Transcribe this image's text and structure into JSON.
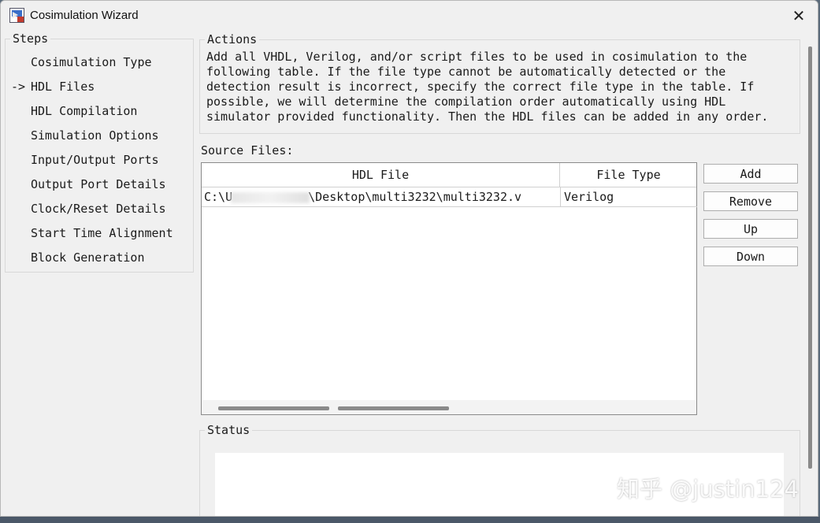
{
  "window": {
    "title": "Cosimulation Wizard",
    "close_glyph": "✕"
  },
  "icons": {
    "app": "cosimulation-app-icon",
    "close": "close-icon"
  },
  "steps": {
    "legend": "Steps",
    "current_marker": "->",
    "items": [
      {
        "label": "Cosimulation Type",
        "current": false
      },
      {
        "label": "HDL Files",
        "current": true
      },
      {
        "label": "HDL Compilation",
        "current": false
      },
      {
        "label": "Simulation Options",
        "current": false
      },
      {
        "label": "Input/Output Ports",
        "current": false
      },
      {
        "label": "Output Port Details",
        "current": false
      },
      {
        "label": "Clock/Reset Details",
        "current": false
      },
      {
        "label": "Start Time Alignment",
        "current": false
      },
      {
        "label": "Block Generation",
        "current": false
      }
    ]
  },
  "actions": {
    "legend": "Actions",
    "text": "Add all VHDL, Verilog, and/or script files to be used in cosimulation to the\nfollowing table. If the file type cannot be automatically detected or the\ndetection result is incorrect, specify the correct file type in the table. If\npossible, we will determine the compilation order automatically using HDL\nsimulator provided functionality. Then the HDL files can be added in any order."
  },
  "source_files": {
    "label": "Source Files:",
    "columns": [
      "HDL File",
      "File Type"
    ],
    "rows": [
      {
        "path_start": "C:\\U",
        "path_end": "\\Desktop\\multi3232\\multi3232.v",
        "file_type": "Verilog"
      }
    ]
  },
  "buttons": {
    "add": "Add",
    "remove": "Remove",
    "up": "Up",
    "down": "Down"
  },
  "status": {
    "legend": "Status"
  },
  "watermark": "知乎 @justin124"
}
